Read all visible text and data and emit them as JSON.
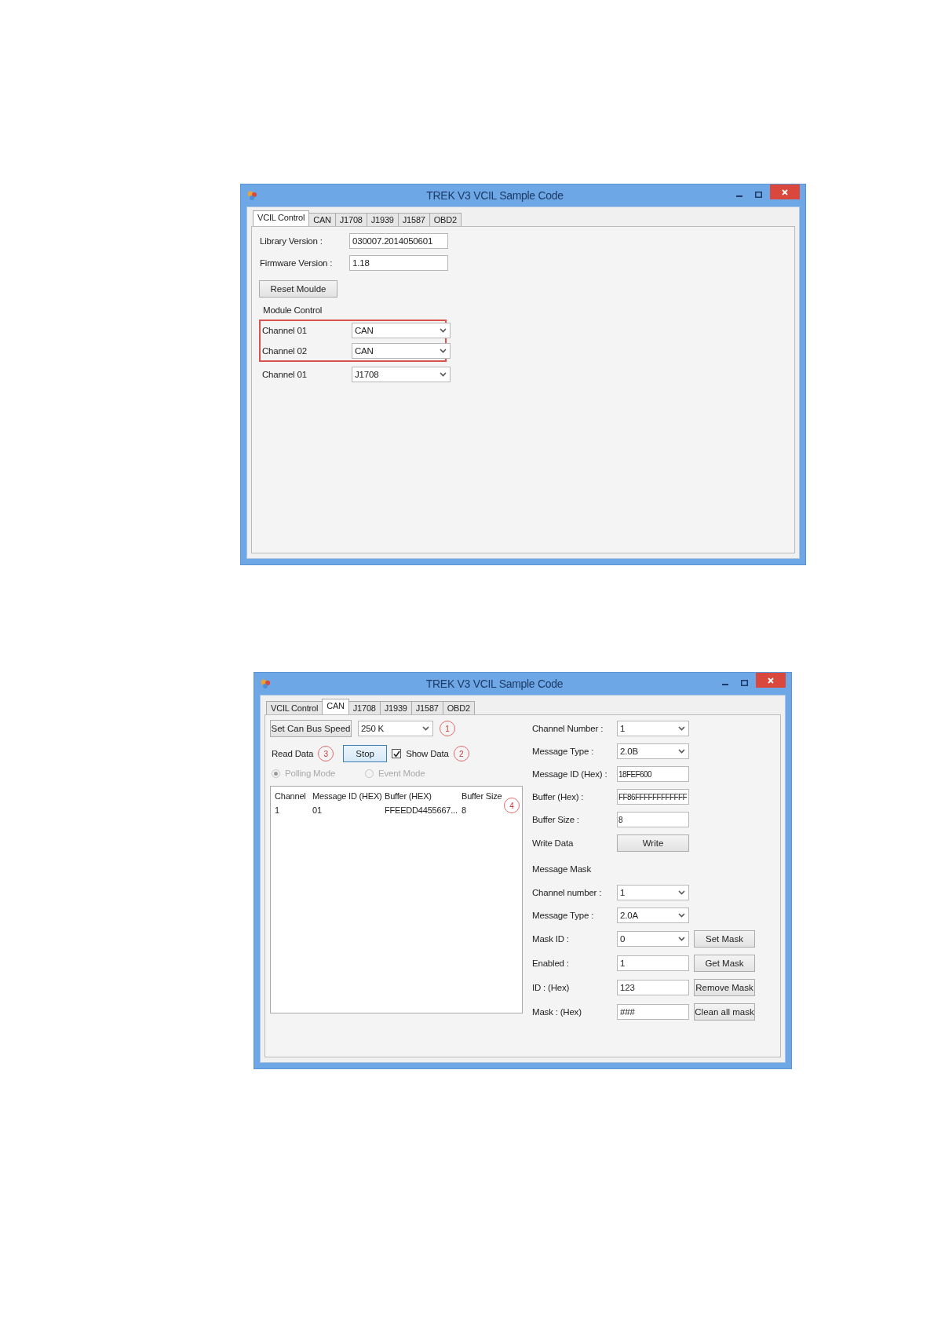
{
  "windows": [
    {
      "kind": "module_control",
      "title": "TREK V3 VCIL Sample Code",
      "tabs": [
        {
          "label": "VCIL Control",
          "selected": true
        },
        {
          "label": "CAN",
          "selected": false
        },
        {
          "label": "J1708",
          "selected": false
        },
        {
          "label": "J1939",
          "selected": false
        },
        {
          "label": "J1587",
          "selected": false
        },
        {
          "label": "OBD2",
          "selected": false
        }
      ],
      "fields": [
        {
          "label": "Library Version :",
          "value": "030007.2014050601"
        },
        {
          "label": "Firmware Version :",
          "value": "1.18"
        }
      ],
      "reset_button": "Reset Moulde",
      "section_label": "Module Control",
      "channels": [
        {
          "label": "Channel 01",
          "value": "CAN",
          "highlighted": true
        },
        {
          "label": "Channel 02",
          "value": "CAN",
          "highlighted": true
        },
        {
          "label": "Channel 01",
          "value": "J1708",
          "highlighted": false
        }
      ]
    },
    {
      "kind": "can",
      "title": "TREK V3 VCIL Sample Code",
      "tabs": [
        {
          "label": "VCIL Control",
          "selected": false
        },
        {
          "label": "CAN",
          "selected": true
        },
        {
          "label": "J1708",
          "selected": false
        },
        {
          "label": "J1939",
          "selected": false
        },
        {
          "label": "J1587",
          "selected": false
        },
        {
          "label": "OBD2",
          "selected": false
        }
      ],
      "bus_speed": {
        "button": "Set Can Bus Speed",
        "value": "250 K",
        "callout": "1"
      },
      "read_data": {
        "label": "Read Data",
        "callout": "3",
        "button": "Stop",
        "show_data": {
          "label": "Show Data",
          "checked": true,
          "callout": "2"
        }
      },
      "modes": [
        {
          "label": "Polling Mode",
          "selected": true,
          "disabled": true
        },
        {
          "label": "Event Mode",
          "selected": false,
          "disabled": true
        }
      ],
      "table": {
        "columns": [
          "Channel",
          "Message ID (HEX)",
          "Buffer (HEX)",
          "Buffer Size"
        ],
        "callout": "4",
        "rows": [
          [
            "1",
            "01",
            "FFEEDD4455667...",
            "8"
          ]
        ]
      },
      "write_fields": [
        {
          "kind": "dropdown",
          "label": "Channel Number :",
          "value": "1"
        },
        {
          "kind": "dropdown",
          "label": "Message Type :",
          "value": "2.0B"
        },
        {
          "kind": "text",
          "label": "Message ID (Hex) :",
          "value": "18FEF600"
        },
        {
          "kind": "text",
          "label": "Buffer (Hex) :",
          "value": "FF86FFFFFFFFFFFF"
        },
        {
          "kind": "text",
          "label": "Buffer Size :",
          "value": "8"
        },
        {
          "kind": "button",
          "label": "Write Data",
          "value": "Write"
        }
      ],
      "mask_label": "Message Mask",
      "mask_fields": [
        {
          "kind": "dropdown",
          "label": "Channel number :",
          "value": "1"
        },
        {
          "kind": "dropdown",
          "label": "Message Type :",
          "value": "2.0A"
        },
        {
          "kind": "dropdown",
          "label": "Mask ID :",
          "value": "0",
          "button": "Set Mask"
        },
        {
          "kind": "text",
          "label": "Enabled :",
          "value": "1",
          "button": "Get Mask"
        },
        {
          "kind": "text",
          "label": "ID : (Hex)",
          "value": "123",
          "button": "Remove Mask"
        },
        {
          "kind": "text",
          "label": "Mask : (Hex)",
          "value": "###",
          "button": "Clean all mask"
        }
      ]
    }
  ]
}
